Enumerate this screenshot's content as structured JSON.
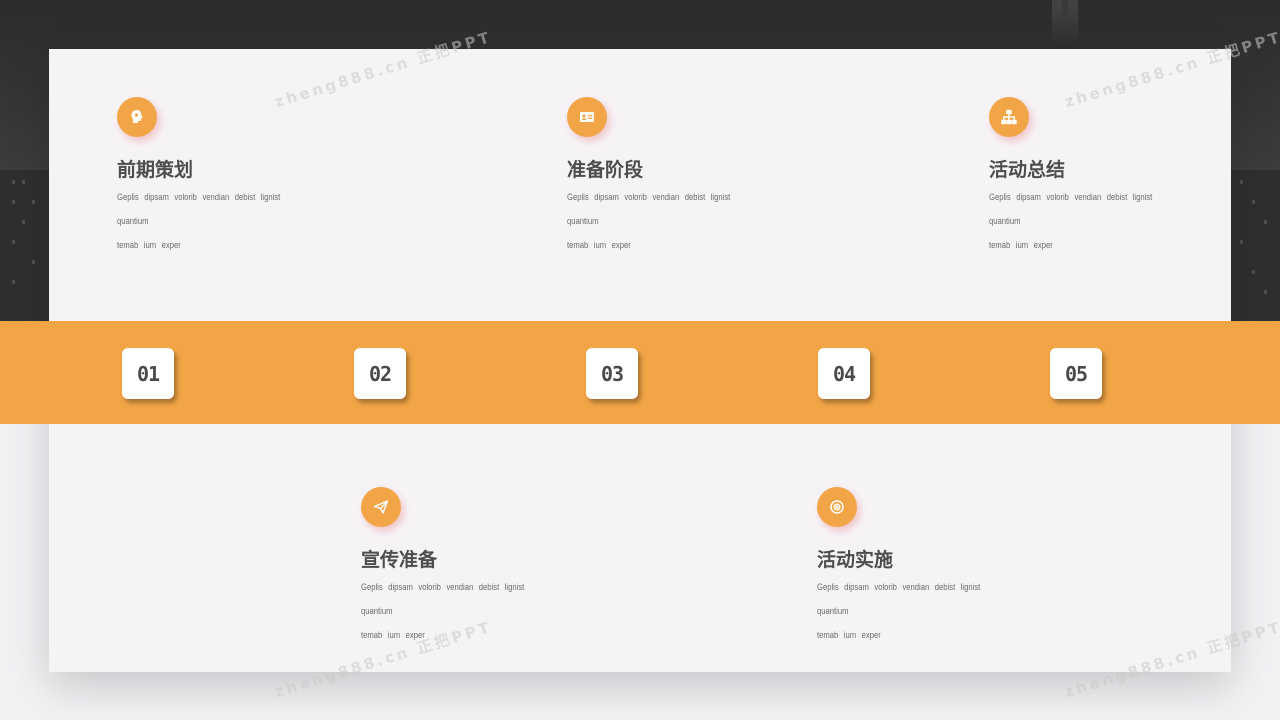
{
  "items": [
    {
      "title": "前期策划",
      "desc_line1": "Geplis dipsam volorib vendian debist lignist quantium",
      "desc_line2": "temab ium exper",
      "icon": "head-idea-icon"
    },
    {
      "title": "准备阶段",
      "desc_line1": "Geplis dipsam volorib vendian debist lignist quantium",
      "desc_line2": "temab ium exper",
      "icon": "id-card-icon"
    },
    {
      "title": "活动总结",
      "desc_line1": "Geplis dipsam volorib vendian debist lignist quantium",
      "desc_line2": "temab ium exper",
      "icon": "org-chart-icon"
    },
    {
      "title": "宣传准备",
      "desc_line1": "Geplis dipsam volorib vendian debist lignist quantium",
      "desc_line2": "temab ium exper",
      "icon": "paper-plane-icon"
    },
    {
      "title": "活动实施",
      "desc_line1": "Geplis dipsam volorib vendian debist lignist quantium",
      "desc_line2": "temab ium exper",
      "icon": "target-icon"
    }
  ],
  "steps": [
    "01",
    "02",
    "03",
    "04",
    "05"
  ],
  "watermark": "zheng888.cn 正把PPT",
  "colors": {
    "accent": "#f2a547",
    "card": "#f6f3f7",
    "text": "#4d4d4d"
  }
}
